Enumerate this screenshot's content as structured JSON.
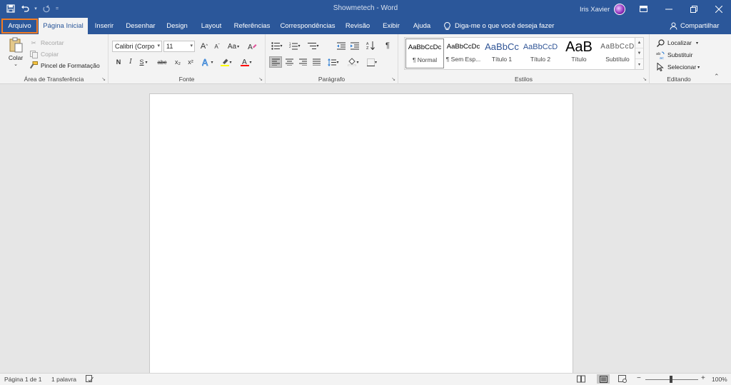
{
  "window": {
    "title": "Showmetech - Word",
    "user": "Iris Xavier"
  },
  "tabs": [
    "Arquivo",
    "Página Inicial",
    "Inserir",
    "Desenhar",
    "Design",
    "Layout",
    "Referências",
    "Correspondências",
    "Revisão",
    "Exibir",
    "Ajuda"
  ],
  "tell_me": "Diga-me o que você deseja fazer",
  "share": "Compartilhar",
  "ribbon": {
    "clipboard": {
      "label": "Área de Transferência",
      "paste": "Colar",
      "cut": "Recortar",
      "copy": "Copiar",
      "format_painter": "Pincel de Formatação"
    },
    "font": {
      "label": "Fonte",
      "family": "Calibri (Corpo",
      "size": "11",
      "grow": "A",
      "shrink": "A",
      "case": "Aa",
      "bold": "N",
      "italic": "I",
      "underline": "S",
      "strike": "abc",
      "subscript": "x₂",
      "superscript": "x²"
    },
    "paragraph": {
      "label": "Parágrafo"
    },
    "styles": {
      "label": "Estilos",
      "items": [
        {
          "sample": "AaBbCcDc",
          "name": "¶ Normal"
        },
        {
          "sample": "AaBbCcDc",
          "name": "¶ Sem Esp..."
        },
        {
          "sample": "AaBbCc",
          "name": "Título 1"
        },
        {
          "sample": "AaBbCcD",
          "name": "Título 2"
        },
        {
          "sample": "AaB",
          "name": "Título"
        },
        {
          "sample": "AaBbCcD",
          "name": "Subtítulo"
        }
      ]
    },
    "editing": {
      "label": "Editando",
      "find": "Localizar",
      "replace": "Substituir",
      "select": "Selecionar"
    }
  },
  "status": {
    "page": "Página 1 de 1",
    "words": "1 palavra",
    "zoom": "100%"
  },
  "colors": {
    "accent": "#2b579a",
    "highlight_border": "#f57b20",
    "highlight_yellow": "#ffff00",
    "font_red": "#ff0000"
  }
}
